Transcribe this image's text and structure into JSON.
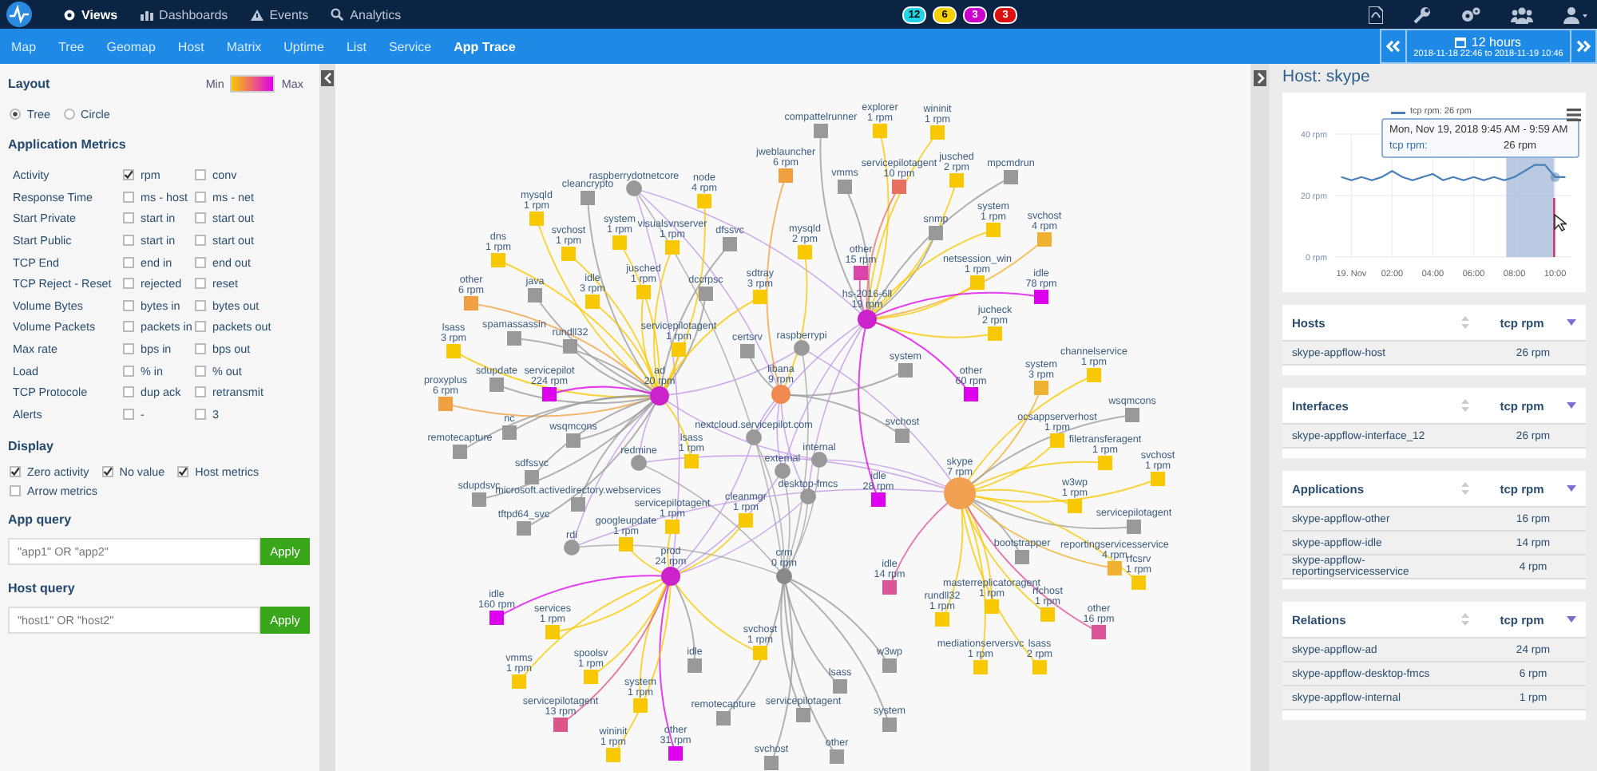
{
  "topnav": {
    "menu": [
      {
        "label": "Views",
        "selected": true
      },
      {
        "label": "Dashboards",
        "selected": false
      },
      {
        "label": "Events",
        "selected": false
      },
      {
        "label": "Analytics",
        "selected": false
      }
    ],
    "badges": [
      {
        "count": "12",
        "color": "#22d3e6"
      },
      {
        "count": "6",
        "color": "#f5d000"
      },
      {
        "count": "3",
        "color": "#cc00cc"
      },
      {
        "count": "3",
        "color": "#dd1111"
      }
    ]
  },
  "tabs": [
    {
      "label": "Map",
      "selected": false
    },
    {
      "label": "Tree",
      "selected": false
    },
    {
      "label": "Geomap",
      "selected": false
    },
    {
      "label": "Host",
      "selected": false
    },
    {
      "label": "Matrix",
      "selected": false
    },
    {
      "label": "Uptime",
      "selected": false
    },
    {
      "label": "List",
      "selected": false
    },
    {
      "label": "Service",
      "selected": false
    },
    {
      "label": "App Trace",
      "selected": true
    }
  ],
  "time_range": {
    "label": "12 hours",
    "range": "2018-11-18 22:46 to 2018-11-19 10:46"
  },
  "sidebar": {
    "layout": {
      "title": "Layout",
      "min_label": "Min",
      "max_label": "Max",
      "options": [
        {
          "label": "Tree",
          "selected": true
        },
        {
          "label": "Circle",
          "selected": false
        }
      ]
    },
    "metrics": {
      "title": "Application Metrics",
      "rows": [
        {
          "label": "Activity",
          "options": [
            {
              "label": "rpm",
              "checked": true
            },
            {
              "label": "conv",
              "checked": false
            }
          ]
        },
        {
          "label": "Response Time",
          "options": [
            {
              "label": "ms - host",
              "checked": false
            },
            {
              "label": "ms - net",
              "checked": false
            }
          ]
        },
        {
          "label": "Start Private",
          "options": [
            {
              "label": "start in",
              "checked": false
            },
            {
              "label": "start out",
              "checked": false
            }
          ]
        },
        {
          "label": "Start Public",
          "options": [
            {
              "label": "start in",
              "checked": false
            },
            {
              "label": "start out",
              "checked": false
            }
          ]
        },
        {
          "label": "TCP End",
          "options": [
            {
              "label": "end in",
              "checked": false
            },
            {
              "label": "end out",
              "checked": false
            }
          ]
        },
        {
          "label": "TCP Reject - Reset",
          "options": [
            {
              "label": "rejected",
              "checked": false
            },
            {
              "label": "reset",
              "checked": false
            }
          ]
        },
        {
          "label": "Volume Bytes",
          "options": [
            {
              "label": "bytes in",
              "checked": false
            },
            {
              "label": "bytes out",
              "checked": false
            }
          ]
        },
        {
          "label": "Volume Packets",
          "options": [
            {
              "label": "packets in",
              "checked": false
            },
            {
              "label": "packets out",
              "checked": false
            }
          ]
        },
        {
          "label": "Max rate",
          "options": [
            {
              "label": "bps in",
              "checked": false
            },
            {
              "label": "bps out",
              "checked": false
            }
          ]
        },
        {
          "label": "Load",
          "options": [
            {
              "label": "% in",
              "checked": false
            },
            {
              "label": "% out",
              "checked": false
            }
          ]
        },
        {
          "label": "TCP Protocole",
          "options": [
            {
              "label": "dup ack",
              "checked": false
            },
            {
              "label": "retransmit",
              "checked": false
            }
          ]
        },
        {
          "label": "Alerts",
          "options": [
            {
              "label": "-",
              "checked": false
            },
            {
              "label": "3",
              "checked": false
            }
          ]
        }
      ]
    },
    "display": {
      "title": "Display",
      "options": [
        {
          "label": "Zero activity",
          "checked": true
        },
        {
          "label": "No value",
          "checked": true
        },
        {
          "label": "Host metrics",
          "checked": true
        },
        {
          "label": "Arrow metrics",
          "checked": false
        }
      ]
    },
    "app_query": {
      "title": "App query",
      "placeholder": "\"app1\" OR \"app2\"",
      "button": "Apply"
    },
    "host_query": {
      "title": "Host query",
      "placeholder": "\"host1\" OR \"host2\"",
      "button": "Apply"
    }
  },
  "graph": {
    "hubs": [
      {
        "label": "hs-2016-6ll",
        "value": "19 rpm",
        "color": "#cc22cc",
        "children": [
          {
            "label": "compattelrunner",
            "color": "#999999"
          },
          {
            "label": "explorer",
            "value": "1 rpm",
            "color": "#f8c800"
          },
          {
            "label": "wininit",
            "value": "1 rpm",
            "color": "#f8c800"
          },
          {
            "label": "vmms",
            "color": "#999999"
          },
          {
            "label": "servicepilotagent",
            "value": "10 rpm",
            "color": "#e87060"
          },
          {
            "label": "jusched",
            "value": "2 rpm",
            "color": "#f8c800"
          },
          {
            "label": "mpcmdrun",
            "color": "#999999"
          },
          {
            "label": "snmp",
            "color": "#999999"
          },
          {
            "label": "system",
            "value": "1 rpm",
            "color": "#f8c800"
          },
          {
            "label": "svchost",
            "value": "4 rpm",
            "color": "#f0b030"
          },
          {
            "label": "other",
            "value": "15 rpm",
            "color": "#dd44aa"
          },
          {
            "label": "netsession_win",
            "value": "1 rpm",
            "color": "#f8c800"
          },
          {
            "label": "idle",
            "value": "78 rpm",
            "color": "#dd00ee"
          },
          {
            "label": "jucheck",
            "value": "2 rpm",
            "color": "#f8c800"
          },
          {
            "label": "other",
            "value": "60 rpm",
            "color": "#dd00ee"
          },
          {
            "label": "idle",
            "value": "28 rpm",
            "color": "#dd00ee"
          }
        ]
      },
      {
        "label": "ad",
        "value": "20 rpm",
        "color": "#cc22cc",
        "children": [
          {
            "label": "cleancrypto",
            "color": "#999999"
          },
          {
            "label": "node",
            "value": "4 rpm",
            "color": "#f8c800"
          },
          {
            "label": "mysqld",
            "value": "1 rpm",
            "color": "#f8c800"
          },
          {
            "label": "system",
            "value": "1 rpm",
            "color": "#f8c800"
          },
          {
            "label": "visualsvnserver",
            "value": "1 rpm",
            "color": "#f8c800"
          },
          {
            "label": "svchost",
            "value": "1 rpm",
            "color": "#f8c800"
          },
          {
            "label": "dfssvc",
            "color": "#999999"
          },
          {
            "label": "dns",
            "value": "1 rpm",
            "color": "#f8c800"
          },
          {
            "label": "java",
            "color": "#999999"
          },
          {
            "label": "idle",
            "value": "3 rpm",
            "color": "#f8c800"
          },
          {
            "label": "jusched",
            "value": "1 rpm",
            "color": "#f8c800"
          },
          {
            "label": "dccrpsc",
            "color": "#999999"
          },
          {
            "label": "sdtray",
            "value": "3 rpm",
            "color": "#f8c800"
          },
          {
            "label": "other",
            "value": "6 rpm",
            "color": "#f0a040"
          },
          {
            "label": "lsass",
            "value": "3 rpm",
            "color": "#f8c800"
          },
          {
            "label": "spamassassin",
            "color": "#999999"
          },
          {
            "label": "rundll32",
            "color": "#999999"
          },
          {
            "label": "servicepilotagent",
            "value": "1 rpm",
            "color": "#f8c800"
          },
          {
            "label": "sdupdate",
            "color": "#999999"
          },
          {
            "label": "servicepilot",
            "value": "224 rpm",
            "color": "#dd00ee"
          },
          {
            "label": "proxyplus",
            "value": "6 rpm",
            "color": "#f0a040"
          },
          {
            "label": "nc",
            "color": "#999999"
          },
          {
            "label": "wsqmcons",
            "color": "#999999"
          },
          {
            "label": "remotecapture",
            "color": "#999999"
          },
          {
            "label": "lsass",
            "value": "1 rpm",
            "color": "#f8c800"
          },
          {
            "label": "sdfssvc",
            "color": "#999999"
          },
          {
            "label": "sdupdsvc",
            "color": "#999999"
          },
          {
            "label": "microsoft.activedirectory.webservices",
            "color": "#999999"
          },
          {
            "label": "tftpd64_svc",
            "color": "#999999"
          }
        ]
      },
      {
        "label": "libana",
        "value": "9 rpm",
        "color": "#f08a50",
        "children": [
          {
            "label": "jweblauncher",
            "value": "6 rpm",
            "color": "#f0a040"
          },
          {
            "label": "mysqld",
            "value": "2 rpm",
            "color": "#f8c800"
          },
          {
            "label": "certsrv",
            "color": "#999999"
          },
          {
            "label": "system",
            "color": "#999999"
          },
          {
            "label": "svchost",
            "color": "#999999"
          }
        ]
      },
      {
        "label": "skype",
        "value": "7 rpm",
        "color": "#f0a050",
        "children": [
          {
            "label": "channelservice",
            "value": "1 rpm",
            "color": "#f8c800"
          },
          {
            "label": "system",
            "value": "3 rpm",
            "color": "#f0b030"
          },
          {
            "label": "wsqmcons",
            "color": "#999999"
          },
          {
            "label": "ocsappserverhost",
            "value": "1 rpm",
            "color": "#f8c800"
          },
          {
            "label": "filetransferagent",
            "value": "1 rpm",
            "color": "#f8c800"
          },
          {
            "label": "svchost",
            "value": "1 rpm",
            "color": "#f8c800"
          },
          {
            "label": "w3wp",
            "value": "1 rpm",
            "color": "#f8c800"
          },
          {
            "label": "servicepilotagent",
            "color": "#999999"
          },
          {
            "label": "bootstrapper",
            "color": "#999999"
          },
          {
            "label": "reportingservicesservice",
            "value": "4 rpm",
            "color": "#f0b030"
          },
          {
            "label": "rfcsrv",
            "value": "1 rpm",
            "color": "#f8c800"
          },
          {
            "label": "idle",
            "value": "14 rpm",
            "color": "#dd5599"
          },
          {
            "label": "masterreplicatoragent",
            "value": "1 rpm",
            "color": "#f8c800"
          },
          {
            "label": "rfchost",
            "value": "1 rpm",
            "color": "#f8c800"
          },
          {
            "label": "rundll32",
            "value": "1 rpm",
            "color": "#f8c800"
          },
          {
            "label": "other",
            "value": "16 rpm",
            "color": "#dd5599"
          },
          {
            "label": "mediationserversvc",
            "value": "1 rpm",
            "color": "#f8c800"
          },
          {
            "label": "lsass",
            "value": "2 rpm",
            "color": "#f8c800"
          }
        ]
      },
      {
        "label": "prod",
        "value": "24 rpm",
        "color": "#cc22cc",
        "children": [
          {
            "label": "servicepilotagent",
            "value": "1 rpm",
            "color": "#f8c800"
          },
          {
            "label": "cleanmgr",
            "value": "1 rpm",
            "color": "#f8c800"
          },
          {
            "label": "googleupdate",
            "value": "1 rpm",
            "color": "#f8c800"
          },
          {
            "label": "idle",
            "value": "160 rpm",
            "color": "#dd00ee"
          },
          {
            "label": "services",
            "value": "1 rpm",
            "color": "#f8c800"
          },
          {
            "label": "svchost",
            "value": "1 rpm",
            "color": "#f8c800"
          },
          {
            "label": "idle",
            "color": "#999999"
          },
          {
            "label": "vmms",
            "value": "1 rpm",
            "color": "#f8c800"
          },
          {
            "label": "spoolsv",
            "value": "1 rpm",
            "color": "#f8c800"
          },
          {
            "label": "system",
            "value": "1 rpm",
            "color": "#f8c800"
          },
          {
            "label": "servicepilotagent",
            "value": "13 rpm",
            "color": "#dd5588"
          },
          {
            "label": "other",
            "value": "31 rpm",
            "color": "#dd00ee"
          },
          {
            "label": "wininit",
            "value": "1 rpm",
            "color": "#f8c800"
          }
        ]
      },
      {
        "label": "crm",
        "value": "0 rpm",
        "color": "#888888",
        "children": [
          {
            "label": "w3wp",
            "color": "#999999"
          },
          {
            "label": "lsass",
            "color": "#999999"
          },
          {
            "label": "remotecapture",
            "color": "#999999"
          },
          {
            "label": "servicepilotagent",
            "color": "#999999"
          },
          {
            "label": "system",
            "color": "#999999"
          },
          {
            "label": "other",
            "color": "#999999"
          },
          {
            "label": "svchost",
            "color": "#999999"
          }
        ]
      }
    ],
    "relays": [
      {
        "label": "raspberrydotnetcore"
      },
      {
        "label": "raspberrypi"
      },
      {
        "label": "nextcloud.servicepilot.com"
      },
      {
        "label": "internal"
      },
      {
        "label": "external"
      },
      {
        "label": "redmine"
      },
      {
        "label": "desktop-fmcs"
      },
      {
        "label": "rdi"
      }
    ]
  },
  "details": {
    "title": "Host: skype",
    "chart": {
      "legend_suffix": ": 26 rpm",
      "tooltip": {
        "title": "Mon, Nov 19, 2018 9:45 AM - 9:59 AM",
        "label": "tcp rpm:",
        "value": "26 rpm"
      },
      "chart_data": {
        "type": "line",
        "x": [
          -0.5,
          0,
          0.5,
          1,
          1.5,
          2,
          2.5,
          3,
          3.5,
          4,
          4.5,
          5,
          5.5,
          6,
          6.5,
          7,
          7.5,
          8,
          8.5,
          9,
          9.5,
          10,
          10.5
        ],
        "series": [
          {
            "name": "tcp rpm",
            "color": "#4a7fb5",
            "values": [
              26,
              25,
              26,
              25,
              26,
              28,
              26,
              25,
              26,
              27,
              25,
              26,
              25,
              26,
              25,
              26,
              25,
              26,
              28,
              30,
              30,
              26,
              26
            ]
          }
        ],
        "ylim": [
          0,
          40
        ],
        "yticks": [
          {
            "value": 0,
            "label": "0 rpm"
          },
          {
            "value": 20,
            "label": "20 rpm"
          },
          {
            "value": 40,
            "label": "40 rpm"
          }
        ],
        "xticks": [
          {
            "value": 0,
            "label": "19. Nov"
          },
          {
            "value": 2,
            "label": "02:00"
          },
          {
            "value": 4,
            "label": "04:00"
          },
          {
            "value": 6,
            "label": "06:00"
          },
          {
            "value": 8,
            "label": "08:00"
          },
          {
            "value": 10,
            "label": "10:00"
          }
        ],
        "xlim": [
          -0.8,
          10.8
        ],
        "grid": true,
        "bands": [
          {
            "axis": "x",
            "from": 7.6,
            "to": 9.95
          }
        ],
        "ref_lines": [
          {
            "axis": "x",
            "value": 9.95
          }
        ]
      }
    },
    "tables": [
      {
        "title": "Hosts",
        "column": "tcp rpm",
        "rows": [
          {
            "name": "skype-appflow-host",
            "value": "26 rpm"
          }
        ]
      },
      {
        "title": "Interfaces",
        "column": "tcp rpm",
        "rows": [
          {
            "name": "skype-appflow-interface_12",
            "value": "26 rpm"
          }
        ]
      },
      {
        "title": "Applications",
        "column": "tcp rpm",
        "rows": [
          {
            "name": "skype-appflow-other",
            "value": "16 rpm"
          },
          {
            "name": "skype-appflow-idle",
            "value": "14 rpm"
          },
          {
            "name": "skype-appflow-reportingservicesservice",
            "value": "4 rpm"
          }
        ]
      },
      {
        "title": "Relations",
        "column": "tcp rpm",
        "rows": [
          {
            "name": "skype-appflow-ad",
            "value": "24 rpm"
          },
          {
            "name": "skype-appflow-desktop-fmcs",
            "value": "6 rpm"
          },
          {
            "name": "skype-appflow-internal",
            "value": "1 rpm"
          }
        ]
      }
    ]
  }
}
